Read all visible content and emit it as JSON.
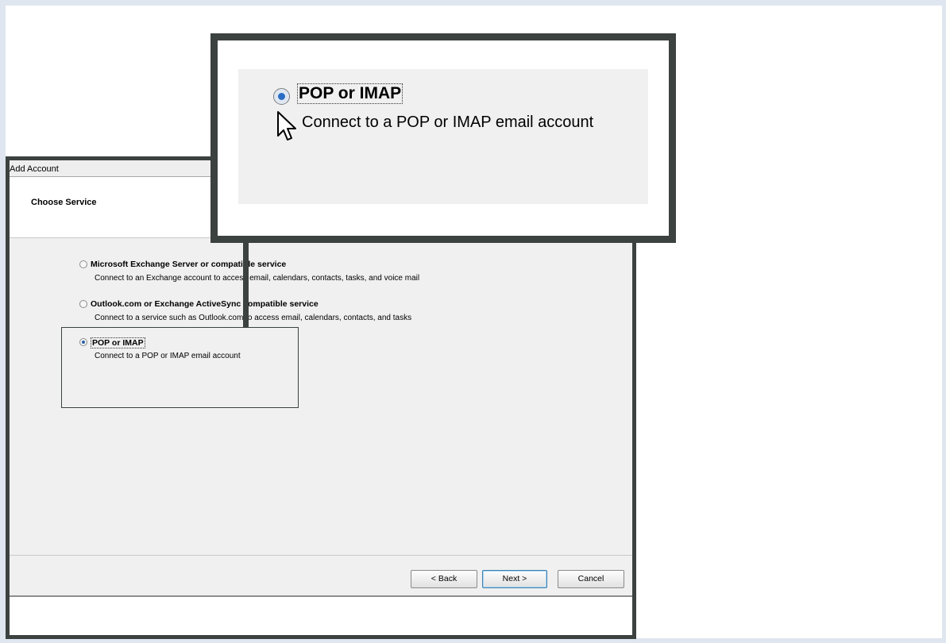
{
  "dialog": {
    "title": "Add Account",
    "header_title": "Choose Service",
    "options": [
      {
        "label": "Microsoft Exchange Server or compatible service",
        "description": "Connect to an Exchange account to access email, calendars, contacts, tasks, and voice mail",
        "selected": false
      },
      {
        "label": "Outlook.com or Exchange ActiveSync compatible service",
        "description": "Connect to a service such as Outlook.com to access email, calendars, contacts, and tasks",
        "selected": false
      },
      {
        "label": "POP or IMAP",
        "description": "Connect to a POP or IMAP email account",
        "selected": true
      }
    ],
    "buttons": {
      "back": "< Back",
      "next": "Next >",
      "cancel": "Cancel"
    }
  },
  "zoom": {
    "label": "POP or IMAP",
    "description": "Connect to a POP or IMAP email account"
  },
  "icons": {
    "cursor": "mouse-pointer-icon",
    "radio": "radio-button-icon"
  },
  "colors": {
    "frame_border": "#3b423f",
    "background_tint": "#dfe6f0",
    "dialog_bg": "#f0f0f0"
  }
}
